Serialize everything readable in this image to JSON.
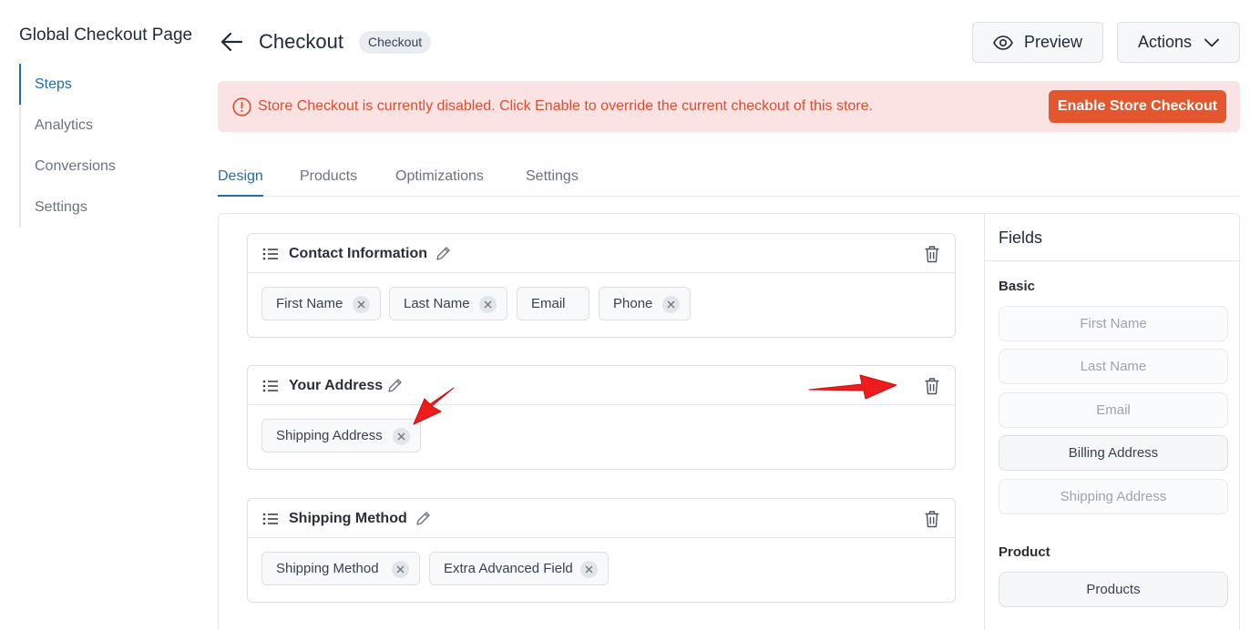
{
  "sidebar": {
    "title": "Global Checkout Page",
    "items": [
      {
        "label": "Steps",
        "active": true
      },
      {
        "label": "Analytics"
      },
      {
        "label": "Conversions"
      },
      {
        "label": "Settings"
      }
    ]
  },
  "header": {
    "title": "Checkout",
    "badge": "Checkout",
    "preview_label": "Preview",
    "actions_label": "Actions"
  },
  "alert": {
    "message": "Store Checkout is currently disabled. Click Enable to override the current checkout of this store.",
    "button_label": "Enable Store Checkout"
  },
  "tabs": [
    {
      "label": "Design",
      "active": true
    },
    {
      "label": "Products"
    },
    {
      "label": "Optimizations"
    },
    {
      "label": "Settings"
    }
  ],
  "steps": [
    {
      "title": "Contact Information",
      "fields": [
        "First Name",
        "Last Name",
        "Email",
        "Phone"
      ]
    },
    {
      "title": "Your Address",
      "fields": [
        "Shipping Address"
      ]
    },
    {
      "title": "Shipping Method",
      "fields": [
        "Shipping Method",
        "Extra Advanced Field"
      ]
    }
  ],
  "fields_panel": {
    "title": "Fields",
    "basic_label": "Basic",
    "basic": [
      {
        "label": "First Name",
        "enabled": false
      },
      {
        "label": "Last Name",
        "enabled": false
      },
      {
        "label": "Email",
        "enabled": false
      },
      {
        "label": "Billing Address",
        "enabled": true
      },
      {
        "label": "Shipping Address",
        "enabled": false
      }
    ],
    "product_label": "Product",
    "product": [
      {
        "label": "Products",
        "enabled": true
      }
    ]
  },
  "colors": {
    "accent": "#1d6fa5",
    "alert_bg": "#fbe3e3",
    "alert_text": "#dc4e2e",
    "enable_button": "#e4572e",
    "annotation_arrow": "#ee1c1c"
  }
}
